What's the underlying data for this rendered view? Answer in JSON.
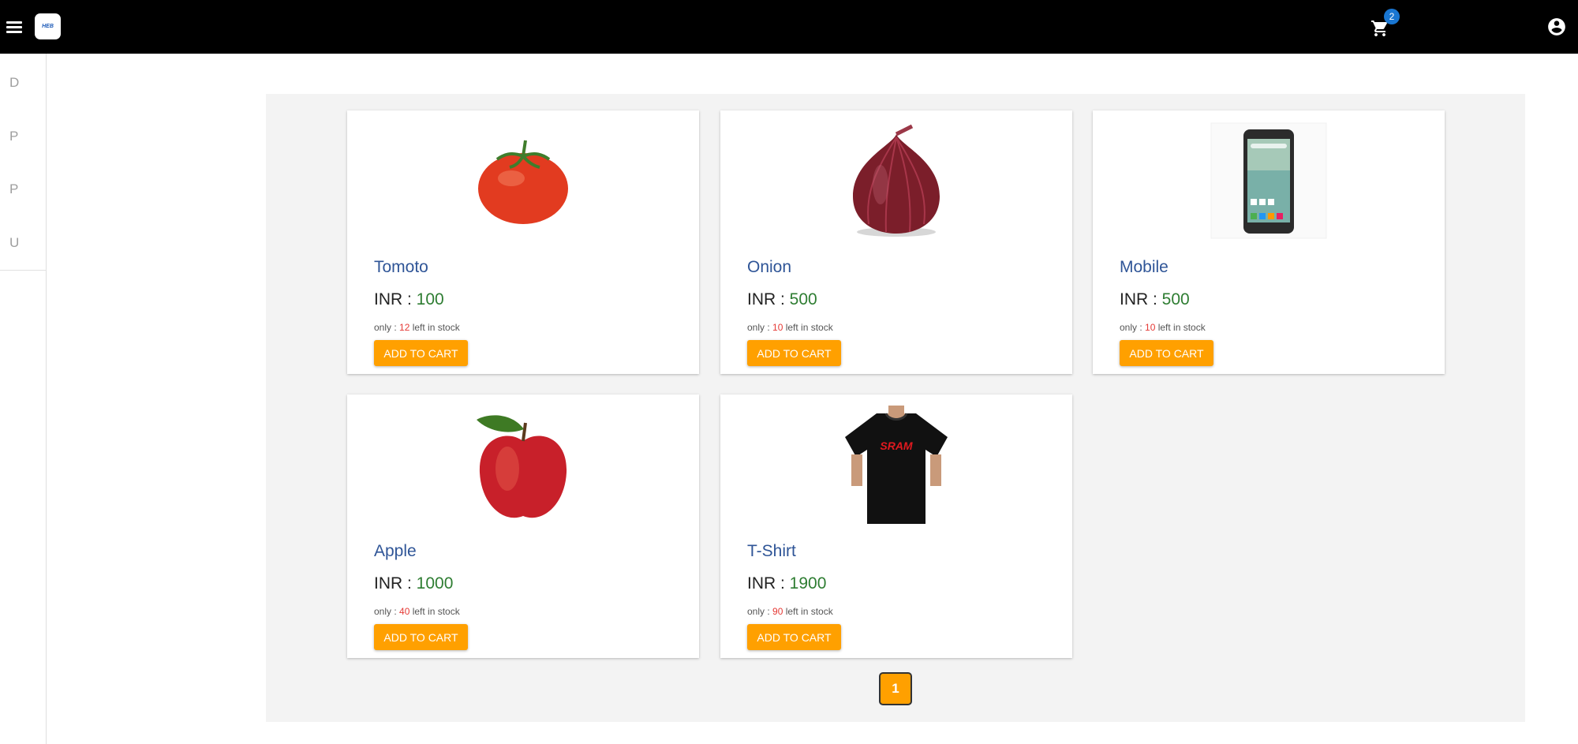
{
  "header": {
    "logo_text": "HEB",
    "cart_count": "2"
  },
  "sidebar": {
    "items": [
      {
        "label": "D"
      },
      {
        "label": "P"
      },
      {
        "label": "P"
      },
      {
        "label": "U"
      }
    ]
  },
  "products": [
    {
      "name": "Tomoto",
      "currency": "INR : ",
      "price": "100",
      "stock_prefix": "only : ",
      "stock_qty": "12",
      "stock_suffix": " left in stock",
      "button": "ADD TO CART",
      "icon": "tomato-image"
    },
    {
      "name": "Onion",
      "currency": "INR : ",
      "price": "500",
      "stock_prefix": "only : ",
      "stock_qty": "10",
      "stock_suffix": " left in stock",
      "button": "ADD TO CART",
      "icon": "onion-image"
    },
    {
      "name": "Mobile",
      "currency": "INR : ",
      "price": "500",
      "stock_prefix": "only : ",
      "stock_qty": "10",
      "stock_suffix": " left in stock",
      "button": "ADD TO CART",
      "icon": "mobile-image"
    },
    {
      "name": "Apple",
      "currency": "INR : ",
      "price": "1000",
      "stock_prefix": "only : ",
      "stock_qty": "40",
      "stock_suffix": " left in stock",
      "button": "ADD TO CART",
      "icon": "apple-image"
    },
    {
      "name": "T-Shirt",
      "currency": "INR : ",
      "price": "1900",
      "stock_prefix": "only : ",
      "stock_qty": "90",
      "stock_suffix": " left in stock",
      "button": "ADD TO CART",
      "icon": "tshirt-image",
      "shirt_print": "SRAM"
    }
  ],
  "pagination": {
    "current_page": "1"
  },
  "colors": {
    "appbar": "#000000",
    "accent": "#ffa000",
    "price": "#2e7d32",
    "stock_qty": "#e53935",
    "product_name": "#2f5597",
    "badge": "#1976d2"
  }
}
